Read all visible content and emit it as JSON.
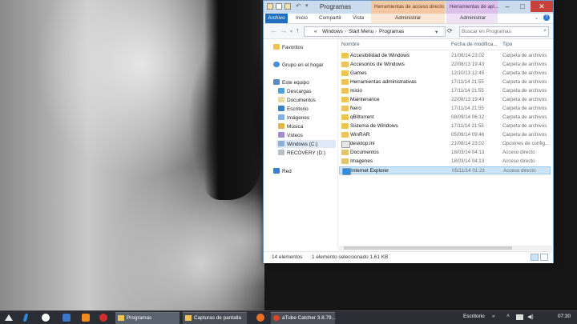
{
  "window": {
    "title": "Programas",
    "contextual_tab_1": "Herramientas de acceso directo",
    "contextual_tab_2": "Herramientas de apl...",
    "ribbon_tabs": [
      "Archivo",
      "Inicio",
      "Compartir",
      "Vista"
    ],
    "contextual_ribbon_1": "Administrar",
    "contextual_ribbon_2": "Administrar",
    "address": [
      "«",
      "Windows",
      "Start Menu",
      "Programas"
    ],
    "search_placeholder": "Buscar en Programas"
  },
  "nav": {
    "favorites": "Favoritos",
    "homegroup": "Grupo en el hogar",
    "this_pc": "Este equipo",
    "items": [
      "Descargas",
      "Documentos",
      "Escritorio",
      "Imágenes",
      "Música",
      "Vídeos",
      "Windows (C:)",
      "RECOVERY (D:)"
    ],
    "network": "Red"
  },
  "columns": [
    "Nombre",
    "Fecha de modifica...",
    "Tipo"
  ],
  "files": [
    {
      "name": "Accesibilidad de Windows",
      "date": "21/08/14 23:02",
      "type": "Carpeta de archivos",
      "icon": "folder"
    },
    {
      "name": "Accesorios de Windows",
      "date": "22/08/13 19:43",
      "type": "Carpeta de archivos",
      "icon": "folder"
    },
    {
      "name": "Games",
      "date": "12/10/13 12:45",
      "type": "Carpeta de archivos",
      "icon": "folder"
    },
    {
      "name": "Herramientas administrativas",
      "date": "17/11/14 21:55",
      "type": "Carpeta de archivos",
      "icon": "folder"
    },
    {
      "name": "Inicio",
      "date": "17/11/14 21:55",
      "type": "Carpeta de archivos",
      "icon": "folder"
    },
    {
      "name": "Maintenance",
      "date": "22/08/13 19:43",
      "type": "Carpeta de archivos",
      "icon": "folder"
    },
    {
      "name": "Nero",
      "date": "17/11/14 21:55",
      "type": "Carpeta de archivos",
      "icon": "folder"
    },
    {
      "name": "qBittorrent",
      "date": "08/09/14 06:12",
      "type": "Carpeta de archivos",
      "icon": "folder"
    },
    {
      "name": "Sistema de Windows",
      "date": "17/11/14 21:55",
      "type": "Carpeta de archivos",
      "icon": "folder"
    },
    {
      "name": "WinRAR",
      "date": "05/09/14 09:46",
      "type": "Carpeta de archivos",
      "icon": "folder"
    },
    {
      "name": "desktop.ini",
      "date": "21/08/14 23:02",
      "type": "Opciones de config...",
      "icon": "ini"
    },
    {
      "name": "Documentos",
      "date": "18/03/14 04:13",
      "type": "Acceso directo",
      "icon": "shortcut"
    },
    {
      "name": "Imagenes",
      "date": "18/03/14 04:13",
      "type": "Acceso directo",
      "icon": "shortcut"
    },
    {
      "name": "Internet Explorer",
      "date": "05/11/14 01:23",
      "type": "Acceso directo",
      "icon": "ie",
      "selected": true
    }
  ],
  "status": {
    "count": "14 elementos",
    "selection": "1 elemento seleccionado  1,61 KB"
  },
  "taskbar": {
    "tasks": [
      "Programas",
      "Capturas de pantalla",
      "aTube Catcher 3.8.79..."
    ],
    "tray_label": "Escritorio",
    "clock": "07:30"
  },
  "colors": {
    "accent": "#1e6fc0",
    "selection": "#cce4f7",
    "folder": "#f0c453"
  }
}
